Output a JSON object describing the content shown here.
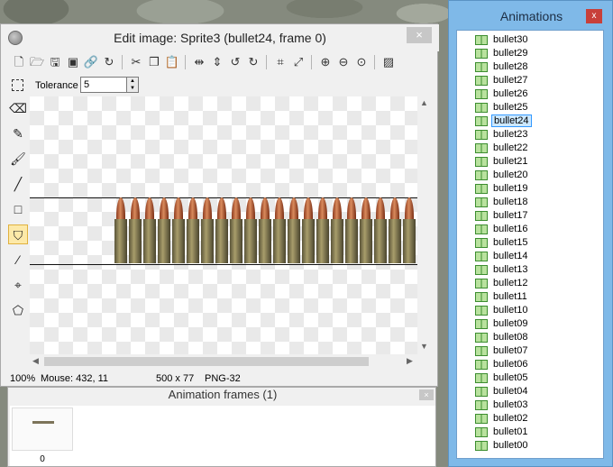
{
  "editor": {
    "title": "Edit image: Sprite3 (bullet24, frame 0)",
    "close_label": "×",
    "tolerance_label": "Tolerance",
    "tolerance_value": "5",
    "status": {
      "zoom": "100%",
      "mouse": "Mouse: 432, 11",
      "size": "500 x 77",
      "format": "PNG-32"
    }
  },
  "frames_panel": {
    "title": "Animation frames (1)",
    "close_label": "×",
    "frames": [
      {
        "label": "0"
      }
    ]
  },
  "animations": {
    "title": "Animations",
    "close_label": "x",
    "selected": "bullet24",
    "items": [
      "bullet30",
      "bullet29",
      "bullet28",
      "bullet27",
      "bullet26",
      "bullet25",
      "bullet24",
      "bullet23",
      "bullet22",
      "bullet21",
      "bullet20",
      "bullet19",
      "bullet18",
      "bullet17",
      "bullet16",
      "bullet15",
      "bullet14",
      "bullet13",
      "bullet12",
      "bullet11",
      "bullet10",
      "bullet09",
      "bullet08",
      "bullet07",
      "bullet06",
      "bullet05",
      "bullet04",
      "bullet03",
      "bullet02",
      "bullet01",
      "bullet00"
    ]
  },
  "toolbar_icons": [
    "new-file-icon",
    "open-folder-icon",
    "save-icon",
    "save-all-icon",
    "link-icon",
    "refresh-icon",
    "cut-icon",
    "copy-icon",
    "paste-icon",
    "flip-horizontal-icon",
    "flip-vertical-icon",
    "rotate-left-icon",
    "rotate-right-icon",
    "crop-icon",
    "resize-icon",
    "zoom-in-icon",
    "zoom-out-icon",
    "zoom-reset-icon",
    "image-properties-icon"
  ],
  "tool_icons": [
    "eraser-icon",
    "pencil-icon",
    "brush-icon",
    "line-icon",
    "rectangle-icon",
    "fill-bucket-icon",
    "color-picker-icon",
    "origin-icon",
    "polygon-icon"
  ],
  "active_tool": "fill-bucket-icon",
  "colors": {
    "window_bg": "#f0f0f0",
    "animations_bg": "#7fb9e8",
    "selection": "#cce8ff",
    "active_tool": "#fde9a8"
  }
}
